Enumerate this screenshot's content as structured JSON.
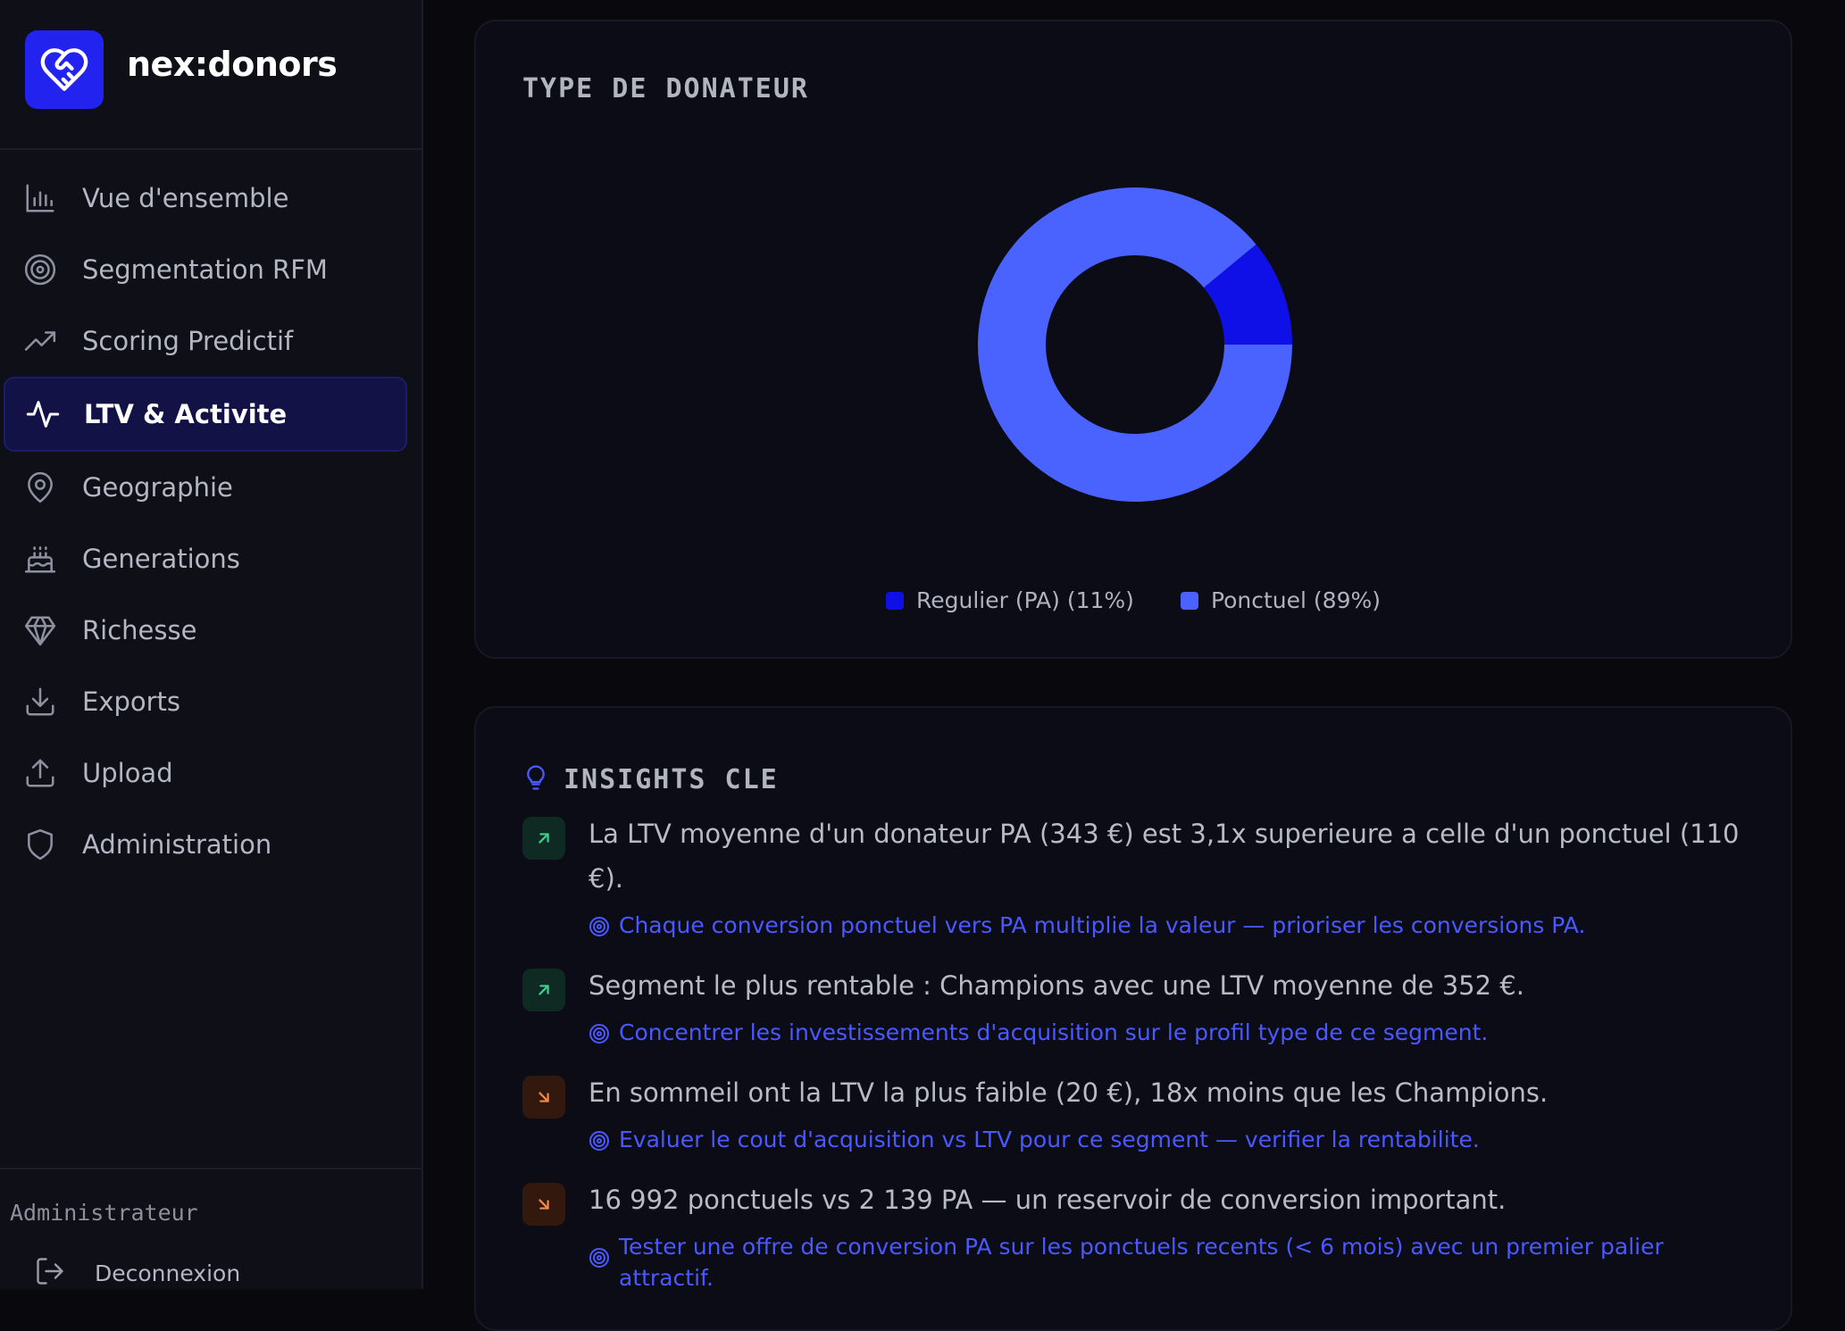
{
  "app": {
    "name": "nex:donors"
  },
  "sidebar": {
    "items": [
      {
        "label": "Vue d'ensemble",
        "icon": "bar-chart-icon",
        "active": false
      },
      {
        "label": "Segmentation RFM",
        "icon": "target-icon",
        "active": false
      },
      {
        "label": "Scoring Predictif",
        "icon": "trending-up-icon",
        "active": false
      },
      {
        "label": "LTV & Activite",
        "icon": "activity-icon",
        "active": true
      },
      {
        "label": "Geographie",
        "icon": "map-pin-icon",
        "active": false
      },
      {
        "label": "Generations",
        "icon": "cake-icon",
        "active": false
      },
      {
        "label": "Richesse",
        "icon": "gem-icon",
        "active": false
      },
      {
        "label": "Exports",
        "icon": "download-icon",
        "active": false
      },
      {
        "label": "Upload",
        "icon": "upload-icon",
        "active": false
      },
      {
        "label": "Administration",
        "icon": "shield-icon",
        "active": false
      }
    ],
    "role": "Administrateur",
    "logout_label": "Deconnexion"
  },
  "donor_type": {
    "title": "TYPE DE DONATEUR",
    "legend": [
      {
        "label": "Regulier (PA) (11%)",
        "color": "#0f0fe8"
      },
      {
        "label": "Ponctuel (89%)",
        "color": "#4a63ff"
      }
    ]
  },
  "chart_data": {
    "type": "pie",
    "donut": true,
    "categories": [
      "Regulier (PA)",
      "Ponctuel"
    ],
    "values": [
      11,
      89
    ],
    "colors": [
      "#0f0fe8",
      "#4a63ff"
    ],
    "legend_position": "bottom"
  },
  "insights": {
    "title": "INSIGHTS CLE",
    "items": [
      {
        "trend": "up",
        "text": "La LTV moyenne d'un donateur PA (343 €) est 3,1x superieure a celle d'un ponctuel (110 €).",
        "action": "Chaque conversion ponctuel vers PA multiplie la valeur — prioriser les conversions PA."
      },
      {
        "trend": "up",
        "text": "Segment le plus rentable : Champions avec une LTV moyenne de 352 €.",
        "action": "Concentrer les investissements d'acquisition sur le profil type de ce segment."
      },
      {
        "trend": "down",
        "text": "En sommeil ont la LTV la plus faible (20 €), 18x moins que les Champions.",
        "action": "Evaluer le cout d'acquisition vs LTV pour ce segment — verifier la rentabilite."
      },
      {
        "trend": "down",
        "text": "16 992 ponctuels vs 2 139 PA — un reservoir de conversion important.",
        "action": "Tester une offre de conversion PA sur les ponctuels recents (< 6 mois) avec un premier palier attractif."
      }
    ]
  },
  "colors": {
    "accent": "#4a59ff",
    "up": "#3fcf8e",
    "down": "#f08a4b"
  }
}
